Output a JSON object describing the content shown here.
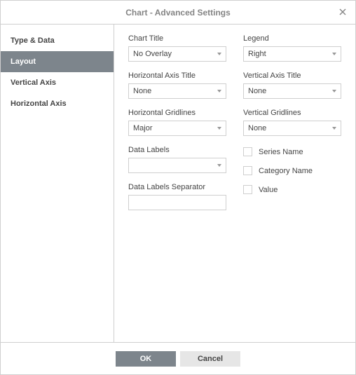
{
  "title": "Chart - Advanced Settings",
  "sidebar": {
    "items": [
      {
        "label": "Type & Data"
      },
      {
        "label": "Layout"
      },
      {
        "label": "Vertical Axis"
      },
      {
        "label": "Horizontal Axis"
      }
    ],
    "activeIndex": 1
  },
  "layout": {
    "chartTitle": {
      "label": "Chart Title",
      "value": "No Overlay"
    },
    "legend": {
      "label": "Legend",
      "value": "Right"
    },
    "hAxisTitle": {
      "label": "Horizontal Axis Title",
      "value": "None"
    },
    "vAxisTitle": {
      "label": "Vertical Axis Title",
      "value": "None"
    },
    "hGridlines": {
      "label": "Horizontal Gridlines",
      "value": "Major"
    },
    "vGridlines": {
      "label": "Vertical Gridlines",
      "value": "None"
    },
    "dataLabels": {
      "label": "Data Labels",
      "value": ""
    },
    "dataLabelsSeparator": {
      "label": "Data Labels Separator",
      "value": ""
    },
    "checkboxes": {
      "seriesName": {
        "label": "Series Name",
        "checked": false
      },
      "categoryName": {
        "label": "Category Name",
        "checked": false
      },
      "value": {
        "label": "Value",
        "checked": false
      }
    }
  },
  "footer": {
    "ok": "OK",
    "cancel": "Cancel"
  }
}
